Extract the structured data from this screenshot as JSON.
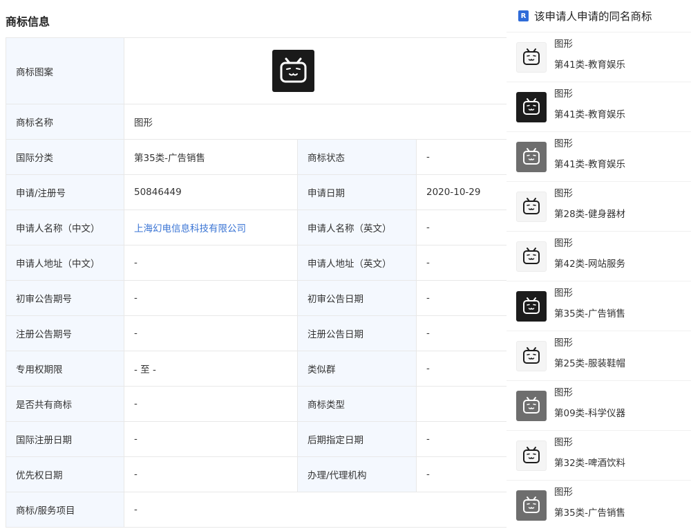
{
  "section": {
    "title": "商标信息"
  },
  "table": {
    "logo_label": "商标图案",
    "name_label": "商标名称",
    "name_value": "图形",
    "rows": [
      {
        "k1": "国际分类",
        "v1": "第35类-广告销售",
        "k2": "商标状态",
        "v2": "-"
      },
      {
        "k1": "申请/注册号",
        "v1": "50846449",
        "k2": "申请日期",
        "v2": "2020-10-29"
      },
      {
        "k1": "申请人名称（中文）",
        "v1": "上海幻电信息科技有限公司",
        "k2": "申请人名称（英文）",
        "v2": "-"
      },
      {
        "k1": "申请人地址（中文）",
        "v1": "-",
        "k2": "申请人地址（英文）",
        "v2": "-"
      },
      {
        "k1": "初审公告期号",
        "v1": "-",
        "k2": "初审公告日期",
        "v2": "-"
      },
      {
        "k1": "注册公告期号",
        "v1": "-",
        "k2": "注册公告日期",
        "v2": "-"
      },
      {
        "k1": "专用权期限",
        "v1": "- 至 -",
        "k2": "类似群",
        "v2": "-"
      },
      {
        "k1": "是否共有商标",
        "v1": "-",
        "k2": "商标类型",
        "v2": ""
      },
      {
        "k1": "国际注册日期",
        "v1": "-",
        "k2": "后期指定日期",
        "v2": "-"
      },
      {
        "k1": "优先权日期",
        "v1": "-",
        "k2": "办理/代理机构",
        "v2": "-"
      }
    ],
    "service_label": "商标/服务项目",
    "service_value": "-"
  },
  "panel": {
    "badge": "R",
    "title": "该申请人申请的同名商标",
    "items": [
      {
        "name": "图形",
        "class": "第41类-教育娱乐",
        "thumb": "white"
      },
      {
        "name": "图形",
        "class": "第41类-教育娱乐",
        "thumb": "black"
      },
      {
        "name": "图形",
        "class": "第41类-教育娱乐",
        "thumb": "gray"
      },
      {
        "name": "图形",
        "class": "第28类-健身器材",
        "thumb": "white"
      },
      {
        "name": "图形",
        "class": "第42类-网站服务",
        "thumb": "white"
      },
      {
        "name": "图形",
        "class": "第35类-广告销售",
        "thumb": "black"
      },
      {
        "name": "图形",
        "class": "第25类-服装鞋帽",
        "thumb": "white"
      },
      {
        "name": "图形",
        "class": "第09类-科学仪器",
        "thumb": "gray"
      },
      {
        "name": "图形",
        "class": "第32类-啤酒饮料",
        "thumb": "white"
      },
      {
        "name": "图形",
        "class": "第35类-广告销售",
        "thumb": "gray"
      }
    ]
  },
  "icons": {
    "logo": "tv-face-logo-icon",
    "badge": "r-badge-icon"
  },
  "colors": {
    "accent": "#3a74d4",
    "key_bg": "#f4f8fe",
    "badge": "#2f6bd8"
  }
}
